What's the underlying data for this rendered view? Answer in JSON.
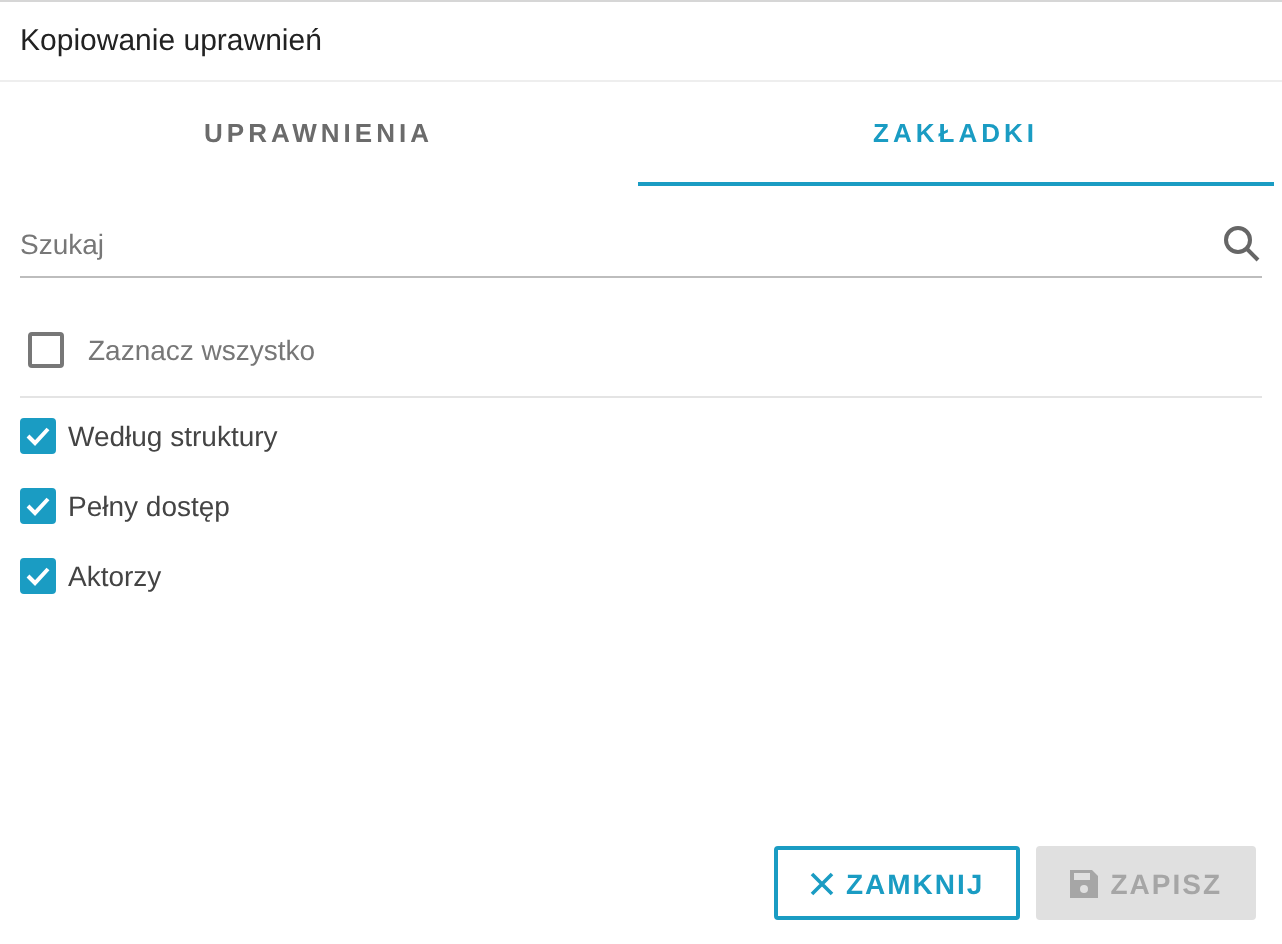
{
  "dialog": {
    "title": "Kopiowanie uprawnień"
  },
  "tabs": [
    {
      "label": "UPRAWNIENIA",
      "selected": false
    },
    {
      "label": "ZAKŁADKI",
      "selected": true
    }
  ],
  "search": {
    "placeholder": "Szukaj"
  },
  "select_all": {
    "label": "Zaznacz wszystko",
    "checked": false
  },
  "items": [
    {
      "label": "Według struktury",
      "checked": true
    },
    {
      "label": "Pełny dostęp",
      "checked": true
    },
    {
      "label": "Aktorzy",
      "checked": true
    }
  ],
  "buttons": [
    {
      "label": "ZAMKNIJ",
      "kind": "close",
      "disabled": false
    },
    {
      "label": "ZAPISZ",
      "kind": "save",
      "disabled": true
    }
  ]
}
